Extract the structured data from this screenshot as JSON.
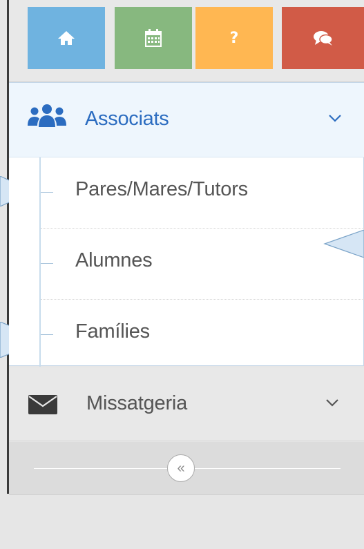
{
  "shortcuts": [
    {
      "icon": "home-icon",
      "color": "#6fb3e0"
    },
    {
      "icon": "calendar-icon",
      "color": "#87b87f"
    },
    {
      "icon": "help-icon",
      "color": "#ffb752",
      "label": "?"
    },
    {
      "icon": "comments-icon",
      "color": "#d15b47"
    }
  ],
  "menu": {
    "associats": {
      "label": "Associats",
      "icon": "users-icon",
      "expanded": true,
      "items": [
        {
          "label": "Pares/Mares/Tutors"
        },
        {
          "label": "Alumnes"
        },
        {
          "label": "Famílies"
        }
      ]
    },
    "missatgeria": {
      "label": "Missatgeria",
      "icon": "envelope-icon",
      "expanded": false
    }
  },
  "collapse": {
    "symbol": "«"
  },
  "colors": {
    "accent": "#2b6cc0",
    "active_bg": "#eef6fd"
  }
}
